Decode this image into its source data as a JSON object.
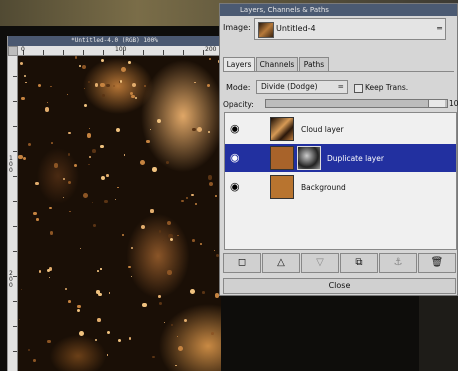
{
  "image_window": {
    "title": "*Untitled-4.0 (RGB) 100%",
    "hruler_labels": [
      "0",
      "100",
      "200"
    ],
    "vruler_labels": [
      "100",
      "200"
    ]
  },
  "layers_dialog": {
    "title": "Layers, Channels & Paths",
    "image_label": "Image:",
    "image_name": "Untitled-4",
    "tabs": [
      {
        "label": "Layers",
        "active": true
      },
      {
        "label": "Channels",
        "active": false
      },
      {
        "label": "Paths",
        "active": false
      }
    ],
    "mode_label": "Mode:",
    "mode_value": "Divide (Dodge)",
    "keep_trans_label": "Keep Trans.",
    "opacity_label": "Opacity:",
    "opacity_value": "10",
    "layers": [
      {
        "name": "Cloud layer",
        "visible_icon": "eye-icon",
        "selected": false,
        "has_mask": false
      },
      {
        "name": "Duplicate layer",
        "visible_icon": "eye-icon",
        "selected": true,
        "has_mask": true
      },
      {
        "name": "Background",
        "visible_icon": "eye-icon",
        "selected": false,
        "has_mask": false
      }
    ],
    "toolbar_icons": [
      "new-layer-icon",
      "raise-layer-icon",
      "lower-layer-icon",
      "duplicate-layer-icon",
      "anchor-icon",
      "trash-icon"
    ],
    "close_label": "Close",
    "selection_color": "#2230a0"
  }
}
